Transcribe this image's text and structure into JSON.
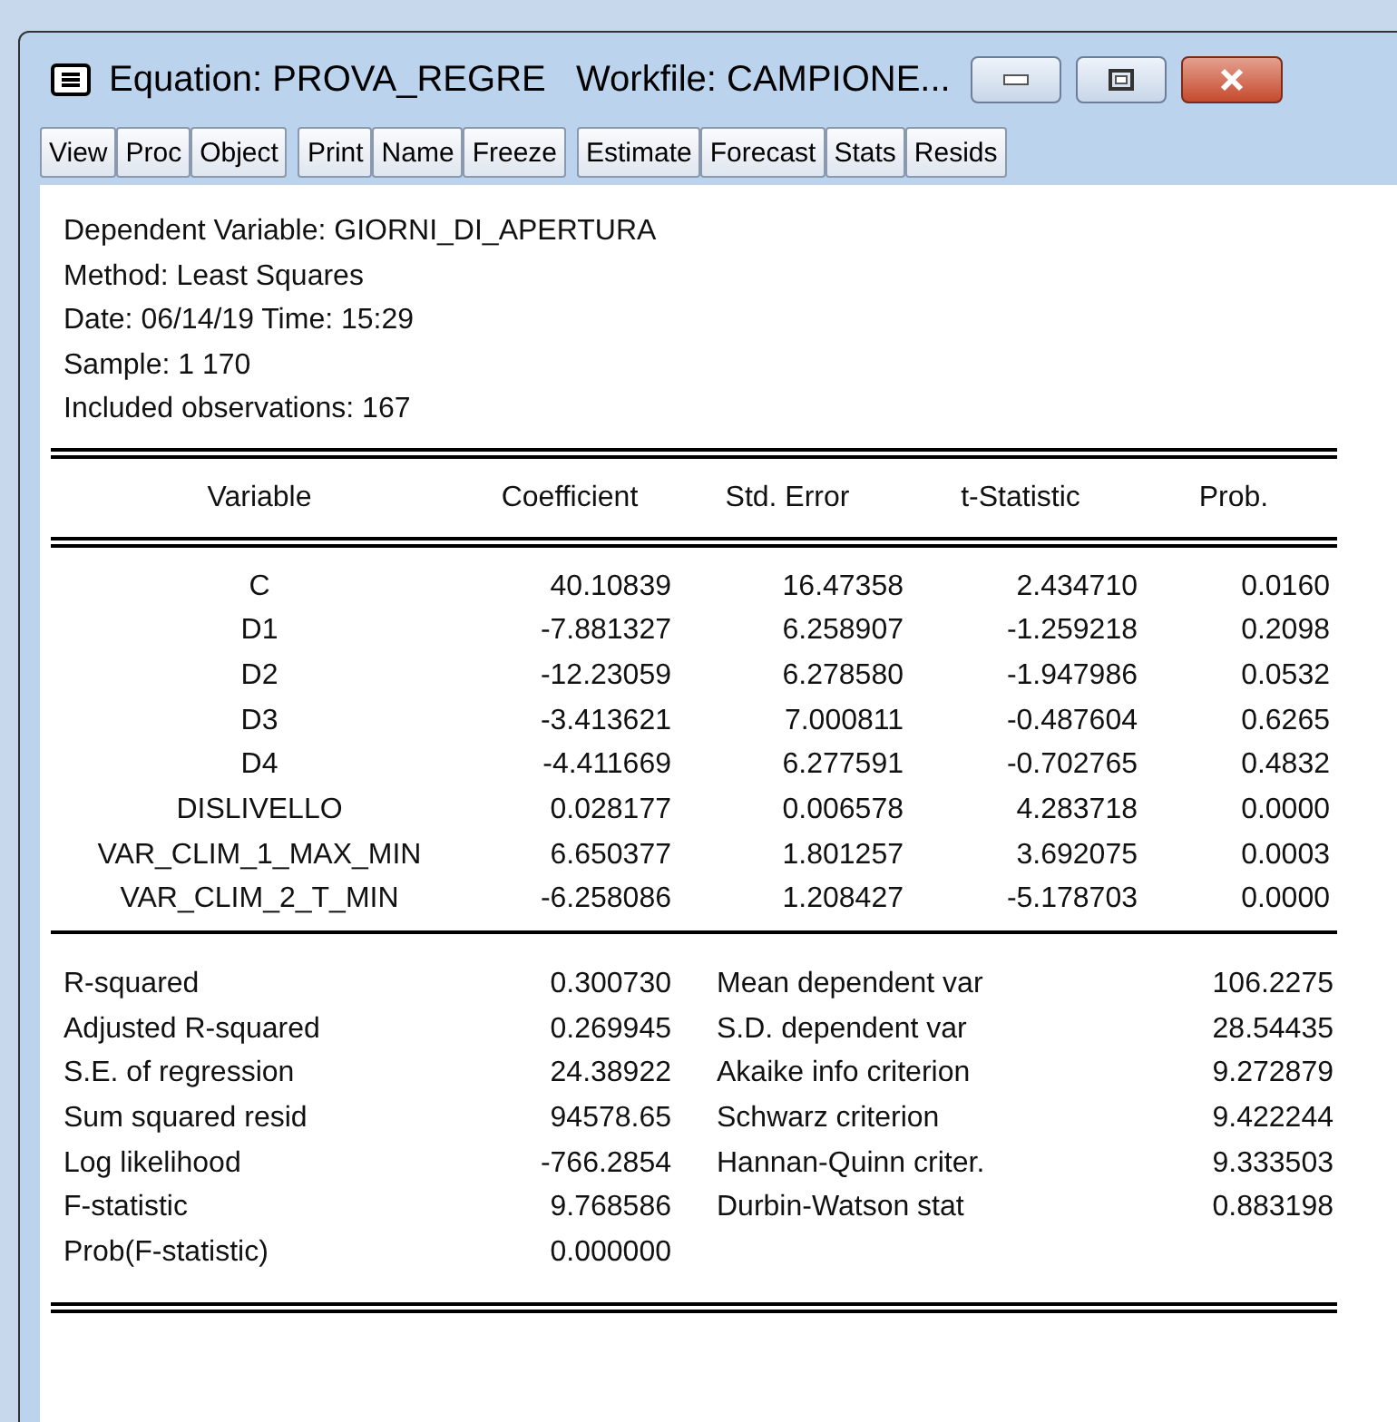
{
  "window": {
    "title": "Equation: PROVA_REGRE   Workfile: CAMPIONE..."
  },
  "toolbar": [
    [
      "View",
      "Proc",
      "Object"
    ],
    [
      "Print",
      "Name",
      "Freeze"
    ],
    [
      "Estimate",
      "Forecast",
      "Stats",
      "Resids"
    ]
  ],
  "header": [
    "Dependent Variable: GIORNI_DI_APERTURA",
    "Method: Least Squares",
    "Date: 06/14/19   Time: 15:29",
    "Sample: 1 170",
    "Included observations: 167"
  ],
  "table": {
    "columns": [
      "Variable",
      "Coefficient",
      "Std. Error",
      "t-Statistic",
      "Prob."
    ],
    "rows": [
      [
        "C",
        "40.10839",
        "16.47358",
        "2.434710",
        "0.0160"
      ],
      [
        "D1",
        "-7.881327",
        "6.258907",
        "-1.259218",
        "0.2098"
      ],
      [
        "D2",
        "-12.23059",
        "6.278580",
        "-1.947986",
        "0.0532"
      ],
      [
        "D3",
        "-3.413621",
        "7.000811",
        "-0.487604",
        "0.6265"
      ],
      [
        "D4",
        "-4.411669",
        "6.277591",
        "-0.702765",
        "0.4832"
      ],
      [
        "DISLIVELLO",
        "0.028177",
        "0.006578",
        "4.283718",
        "0.0000"
      ],
      [
        "VAR_CLIM_1_MAX_MIN",
        "6.650377",
        "1.801257",
        "3.692075",
        "0.0003"
      ],
      [
        "VAR_CLIM_2_T_MIN",
        "-6.258086",
        "1.208427",
        "-5.178703",
        "0.0000"
      ]
    ]
  },
  "statistics": [
    [
      "R-squared",
      "0.300730",
      "Mean dependent var",
      "106.2275"
    ],
    [
      "Adjusted R-squared",
      "0.269945",
      "S.D. dependent var",
      "28.54435"
    ],
    [
      "S.E. of regression",
      "24.38922",
      "Akaike info criterion",
      "9.272879"
    ],
    [
      "Sum squared resid",
      "94578.65",
      "Schwarz criterion",
      "9.422244"
    ],
    [
      "Log likelihood",
      "-766.2854",
      "Hannan-Quinn criter.",
      "9.333503"
    ],
    [
      "F-statistic",
      "9.768586",
      "Durbin-Watson stat",
      "0.883198"
    ],
    [
      "Prob(F-statistic)",
      "0.000000"
    ]
  ]
}
